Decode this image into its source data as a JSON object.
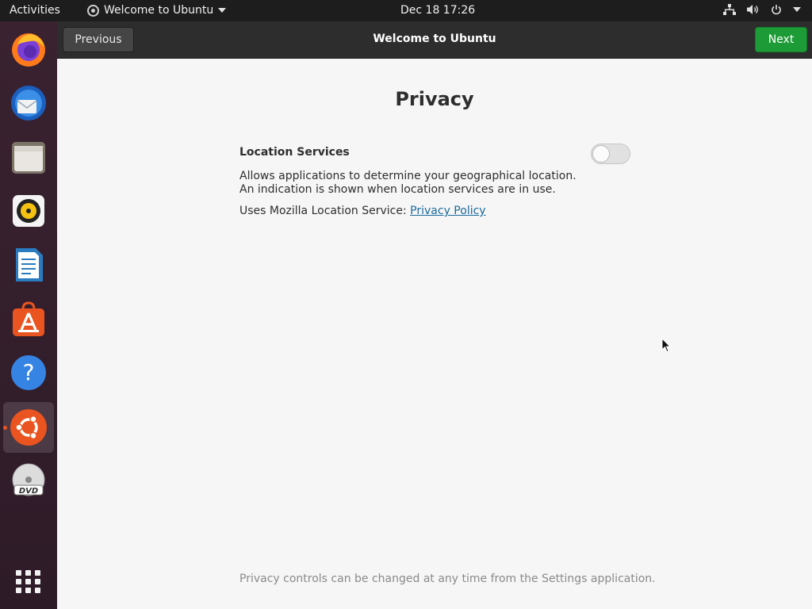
{
  "topbar": {
    "activities": "Activities",
    "app_menu_label": "Welcome to Ubuntu",
    "clock": "Dec 18  17:26"
  },
  "dock": {
    "items": [
      {
        "name": "firefox",
        "icon": "firefox-icon"
      },
      {
        "name": "thunderbird",
        "icon": "thunderbird-icon"
      },
      {
        "name": "files",
        "icon": "files-icon"
      },
      {
        "name": "rhythmbox",
        "icon": "rhythmbox-icon"
      },
      {
        "name": "libreoffice-writer",
        "icon": "writer-icon"
      },
      {
        "name": "ubuntu-software",
        "icon": "software-icon"
      },
      {
        "name": "help",
        "icon": "help-icon"
      },
      {
        "name": "ubuntu-welcome",
        "icon": "ubuntu-icon",
        "active": true
      },
      {
        "name": "dvd",
        "icon": "dvd-icon"
      },
      {
        "name": "show-applications",
        "icon": "app-grid-icon"
      }
    ],
    "accent": "#e95420"
  },
  "window": {
    "title": "Welcome to Ubuntu",
    "previous_label": "Previous",
    "next_label": "Next",
    "next_color": "#1d9b36"
  },
  "page": {
    "title": "Privacy",
    "location_label": "Location Services",
    "location_desc": "Allows applications to determine your geographical location. An indication is shown when location services are in use.",
    "policy_prefix": "Uses Mozilla Location Service: ",
    "policy_link": "Privacy Policy",
    "location_enabled": false,
    "footer": "Privacy controls can be changed at any time from the Settings application."
  }
}
